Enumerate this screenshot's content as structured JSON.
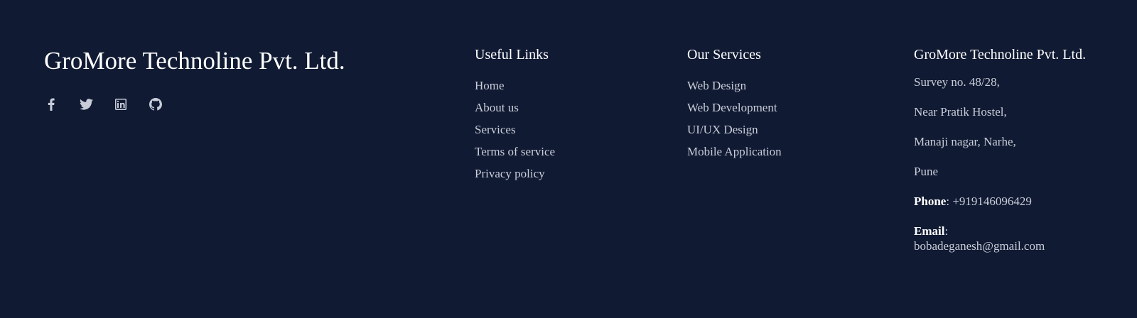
{
  "brand": {
    "title": "GroMore Technoline Pvt. Ltd."
  },
  "social": [
    {
      "icon": "facebook-icon"
    },
    {
      "icon": "twitter-icon"
    },
    {
      "icon": "linkedin-icon"
    },
    {
      "icon": "github-icon"
    }
  ],
  "useful_links": {
    "heading": "Useful Links",
    "items": [
      "Home",
      "About us",
      "Services",
      "Terms of service",
      "Privacy policy"
    ]
  },
  "services": {
    "heading": "Our Services",
    "items": [
      "Web Design",
      "Web Development",
      "UI/UX Design",
      "Mobile Application"
    ]
  },
  "contact": {
    "heading": "GroMore Technoline Pvt. Ltd.",
    "address": [
      "Survey no. 48/28,",
      "Near Pratik Hostel,",
      "Manaji nagar, Narhe,",
      "Pune"
    ],
    "phone_label": "Phone",
    "phone_sep": ": ",
    "phone": "+919146096429",
    "email_label": "Email",
    "email_sep": ":",
    "email": "bobadeganesh@gmail.com"
  },
  "colors": {
    "background": "#101a33",
    "heading": "#ffffff",
    "text": "#c9ced9"
  }
}
